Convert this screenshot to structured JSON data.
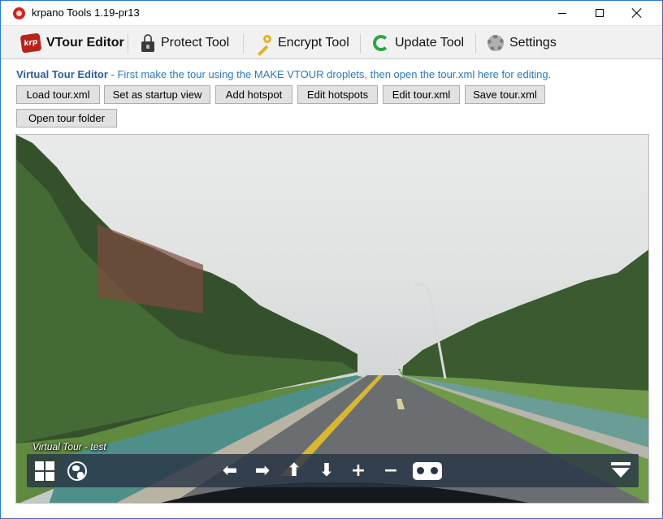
{
  "window": {
    "title": "krpano Tools 1.19-pr13",
    "icon": "krpano-app-icon",
    "controls": [
      "minimize-icon",
      "maximize-icon",
      "close-icon"
    ]
  },
  "toolbar": {
    "tabs": [
      {
        "label": "VTour Editor",
        "icon": "krpano-logo-icon",
        "active": true
      },
      {
        "label": "Protect Tool",
        "icon": "lock-icon",
        "active": false
      },
      {
        "label": "Encrypt Tool",
        "icon": "key-icon",
        "active": false
      },
      {
        "label": "Update Tool",
        "icon": "refresh-icon",
        "active": false
      },
      {
        "label": "Settings",
        "icon": "gear-icon",
        "active": false
      }
    ],
    "krpano_logo_text": "krp"
  },
  "description": {
    "title": "Virtual Tour Editor",
    "text": " - First make the tour using the MAKE VTOUR droplets, then open the tour.xml here for editing."
  },
  "buttons": {
    "load": "Load tour.xml",
    "startup": "Set as startup view",
    "add_hotspot": "Add hotspot",
    "edit_hotspots": "Edit hotspots",
    "edit_xml": "Edit tour.xml",
    "save": "Save tour.xml",
    "open_folder": "Open tour folder"
  },
  "viewer": {
    "scene_title": "Virtual Tour - test",
    "controls": [
      "thumbnails-icon",
      "globe-icon",
      "arrow-left-icon",
      "arrow-right-icon",
      "arrow-up-icon",
      "arrow-down-icon",
      "zoom-in-icon",
      "zoom-out-icon",
      "vr-headset-icon",
      "hide-controls-icon"
    ],
    "glyphs": {
      "left": "⬅",
      "right": "➡",
      "up": "⬆",
      "down": "⬇",
      "in": "+",
      "out": "−"
    }
  },
  "colors": {
    "accent": "#2d78b6",
    "window_border": "#2b79d8",
    "control_bar": "#283446"
  }
}
